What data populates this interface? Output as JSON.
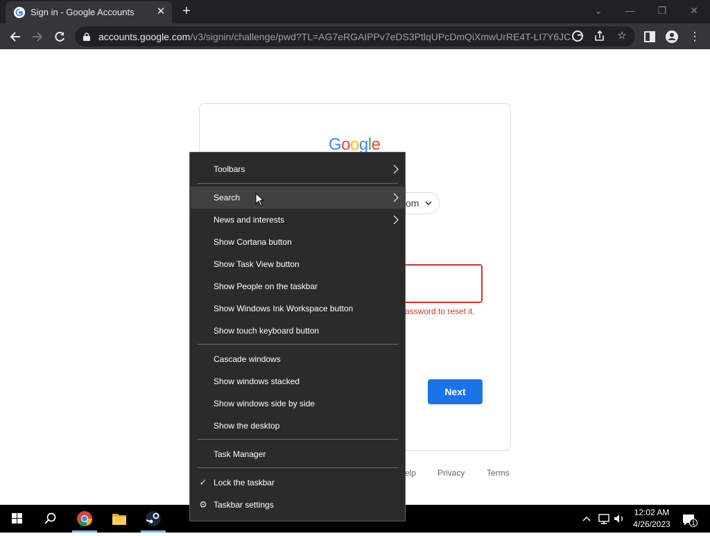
{
  "browser": {
    "tab_title": "Sign in - Google Accounts",
    "tab_close_glyph": "✕",
    "new_tab_glyph": "+",
    "url_domain": "accounts.google.com",
    "url_path": "/v3/signin/challenge/pwd?TL=AG7eRGAIPPv7eDS3PtlqUPcDmQiXmwUrRE4T-LI7Y6JC..."
  },
  "signin": {
    "logo_letters": [
      "G",
      "o",
      "o",
      "g",
      "l",
      "e"
    ],
    "account_chip_text": "om",
    "error_text": "assword to reset it.",
    "next_label": "Next",
    "footer": {
      "help": "elp",
      "privacy": "Privacy",
      "terms": "Terms"
    }
  },
  "context_menu": {
    "items": [
      {
        "label": "Toolbars",
        "submenu": true
      },
      {
        "label": "Search",
        "submenu": true,
        "highlighted": true
      },
      {
        "label": "News and interests",
        "submenu": true
      },
      {
        "label": "Show Cortana button"
      },
      {
        "label": "Show Task View button"
      },
      {
        "label": "Show People on the taskbar"
      },
      {
        "label": "Show Windows Ink Workspace button"
      },
      {
        "label": "Show touch keyboard button"
      },
      {
        "label": "Cascade windows"
      },
      {
        "label": "Show windows stacked"
      },
      {
        "label": "Show windows side by side"
      },
      {
        "label": "Show the desktop"
      },
      {
        "label": "Task Manager"
      },
      {
        "label": "Lock the taskbar",
        "checked": true
      },
      {
        "label": "Taskbar settings",
        "icon": "gear-icon"
      }
    ]
  },
  "taskbar": {
    "time": "12:02 AM",
    "date": "4/26/2023",
    "notification_count": "1"
  },
  "colors": {
    "google_blue": "#4285f4",
    "google_red": "#ea4335",
    "google_yellow": "#fbbc05",
    "google_green": "#34a853",
    "error_red": "#d93025",
    "button_blue": "#1a73e8",
    "menu_bg": "#2b2b2b"
  }
}
